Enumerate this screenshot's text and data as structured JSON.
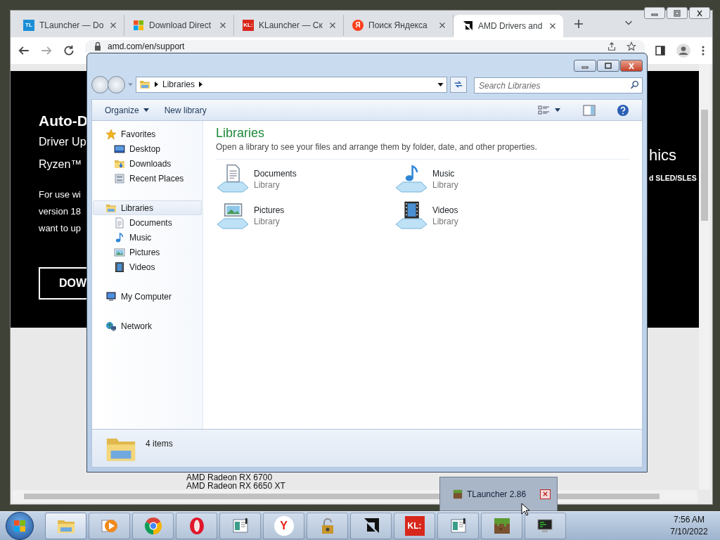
{
  "browser": {
    "tabs": [
      {
        "label": "TLauncher — Do",
        "badge": "TL",
        "selected": false
      },
      {
        "label": "Download Direct",
        "selected": false
      },
      {
        "label": "KLauncher — Ск",
        "badge": "KL:",
        "selected": false
      },
      {
        "label": "Поиск Яндекса",
        "badge": "Я",
        "selected": false
      },
      {
        "label": "AMD Drivers and",
        "selected": true
      }
    ],
    "url": "amd.com/en/support",
    "page": {
      "title": "Auto-D",
      "subtitle_lines": [
        "Driver Up",
        "Ryzen™"
      ],
      "body_lines": [
        "For use wi",
        "version 18",
        "want to up"
      ],
      "button": "DOW",
      "right_title": "hics",
      "right_text": "d SLED/SLES",
      "list": [
        "AMD Radeon RX 6700",
        "AMD Radeon RX 6650 XT"
      ]
    }
  },
  "explorer": {
    "breadcrumb": "Libraries",
    "search": {
      "placeholder": "Search Libraries"
    },
    "toolbar": [
      {
        "label": "Organize",
        "dropdown": true
      },
      {
        "label": "New library",
        "dropdown": false
      }
    ],
    "nav": [
      {
        "label": "Favorites",
        "selected": false,
        "children": [
          {
            "label": "Desktop",
            "selected": false
          },
          {
            "label": "Downloads",
            "selected": false
          },
          {
            "label": "Recent Places",
            "selected": false
          }
        ]
      },
      {
        "label": "Libraries",
        "selected": true,
        "children": [
          {
            "label": "Documents",
            "selected": false
          },
          {
            "label": "Music",
            "selected": false
          },
          {
            "label": "Pictures",
            "selected": false
          },
          {
            "label": "Videos",
            "selected": false
          }
        ]
      },
      {
        "label": "My Computer",
        "selected": false
      },
      {
        "label": "Network",
        "selected": false
      }
    ],
    "heading": "Libraries",
    "description": "Open a library to see your files and arrange them by folder, date, and other properties.",
    "libraries": [
      {
        "name": "Documents",
        "type": "Library"
      },
      {
        "name": "Music",
        "type": "Library"
      },
      {
        "name": "Pictures",
        "type": "Library"
      },
      {
        "name": "Videos",
        "type": "Library"
      }
    ],
    "status": "4 items"
  },
  "tooltip": {
    "label": "TLauncher 2.86"
  },
  "taskbar": {
    "items": [
      {
        "selected": true
      },
      {
        "selected": false
      },
      {
        "selected": false
      },
      {
        "selected": false
      },
      {
        "selected": false
      },
      {
        "badge": "Y",
        "selected": false
      },
      {
        "selected": false
      },
      {
        "selected": false
      },
      {
        "badge": "KL:",
        "selected": false
      },
      {
        "selected": false
      },
      {
        "selected": false
      },
      {
        "selected": false
      }
    ],
    "time": "7:56 AM",
    "date": "7/10/2022"
  }
}
